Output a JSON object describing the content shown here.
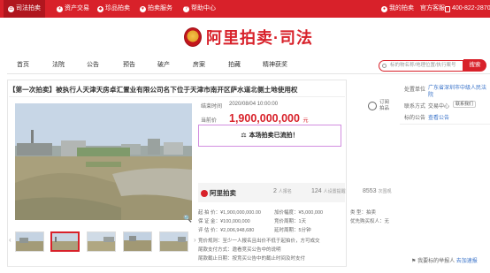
{
  "topbar": {
    "site": "司法拍卖",
    "assets": "资产交易",
    "pearl": "珍品拍卖",
    "auction_service": "拍卖服务",
    "help": "帮助中心",
    "my_auction": "我的拍卖",
    "account": "官方客服",
    "phone": "400-822-2870"
  },
  "logo": {
    "text": "阿里拍卖·司法"
  },
  "nav": {
    "items": [
      "首页",
      "法院",
      "公告",
      "预告",
      "破产",
      "房案",
      "拍藏",
      "精神获奖"
    ],
    "search_placeholder": "标的物名称/地理位置/执行案号",
    "search_button": "搜索"
  },
  "item": {
    "title": "【第一次拍卖】被执行人天津天房卓汇置业有限公司名下位于天津市南开区萨水道北侧土地使用权",
    "end_label": "结束时间",
    "end_time": "2020/08/04 10:00:00",
    "current_label": "当前价",
    "price": "1,900,000,000",
    "price_unit": "元",
    "remind": "订阅拍品",
    "notice": "本场拍卖已流拍！",
    "platform": "阿里拍卖",
    "bidders_count": "2",
    "bidders_label": "人报名",
    "remind_count": "124",
    "remind_label": "人设置提醒",
    "views_count": "8553",
    "views_label": "次围观",
    "details": [
      {
        "label": "起 拍 价",
        "value": "¥1,900,000,000.00"
      },
      {
        "label": "加价幅度",
        "value": "¥5,000,000"
      },
      {
        "label": "类    型",
        "value": "拍卖"
      },
      {
        "label": "保 证 金",
        "value": "¥100,000,000"
      },
      {
        "label": "竞价周期",
        "value": "1天"
      },
      {
        "label": "优先购买权人",
        "value": "无"
      },
      {
        "label": "评 估 价",
        "value": "¥2,006,948,680"
      },
      {
        "label": "延时周期",
        "value": "5分钟"
      }
    ],
    "rules": [
      "竞价规则：至少一人报名且出价不低于起拍价，方可成交",
      "尾款支付方式：邀看竞买公告中的说明",
      "尾款截止日期：按竞买公告中的截止时间及时支付"
    ]
  },
  "right": {
    "court_label": "处置单位",
    "court": "广东省深圳市中级人民法院",
    "contact_label": "联系方式",
    "contact": "交易中心",
    "contact_btn": "联系我们",
    "consult_label": "标的公告",
    "consult_link": "查看公告",
    "report_text": "我要标的举报人",
    "report_link": "去加速报"
  }
}
